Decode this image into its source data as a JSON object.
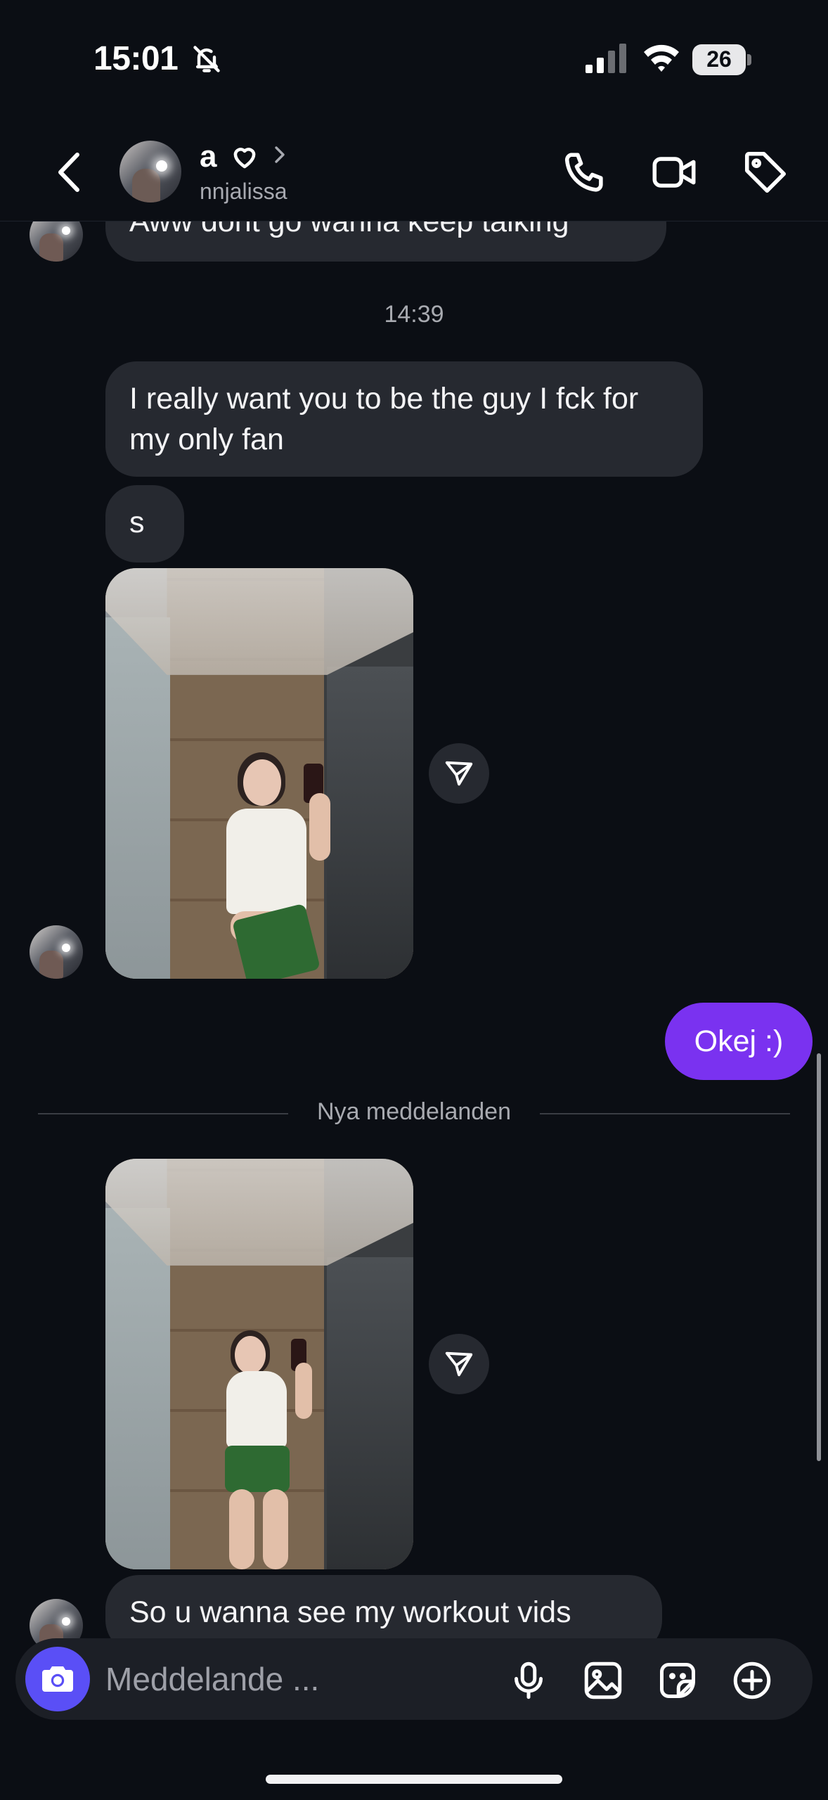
{
  "status_bar": {
    "time": "15:01",
    "battery": "26",
    "icons": [
      "bell-off-icon",
      "signal-icon",
      "wifi-icon",
      "battery-icon"
    ]
  },
  "header": {
    "name": "a",
    "username": "nnjalissa",
    "icons": [
      "back-icon",
      "heart-icon",
      "chevron-right-icon",
      "phone-icon",
      "video-icon",
      "tag-icon"
    ]
  },
  "messages": {
    "partial_top": "Aww dont go wanna keep talking",
    "timestamp": "14:39",
    "msg1": "I really want you to be the guy I fck for my only fan",
    "msg2": "s",
    "outgoing": "Okej :)",
    "divider": "Nya meddelanden",
    "last": "So u wanna see my workout vids"
  },
  "composer": {
    "placeholder": "Meddelande ...",
    "icons": [
      "camera-icon",
      "microphone-icon",
      "gallery-icon",
      "sticker-icon",
      "plus-circle-icon"
    ]
  },
  "colors": {
    "background": "#0b0e14",
    "incoming_bubble": "#262930",
    "outgoing_bubble": "#7a32f0",
    "camera_button": "#5a4ff6"
  }
}
